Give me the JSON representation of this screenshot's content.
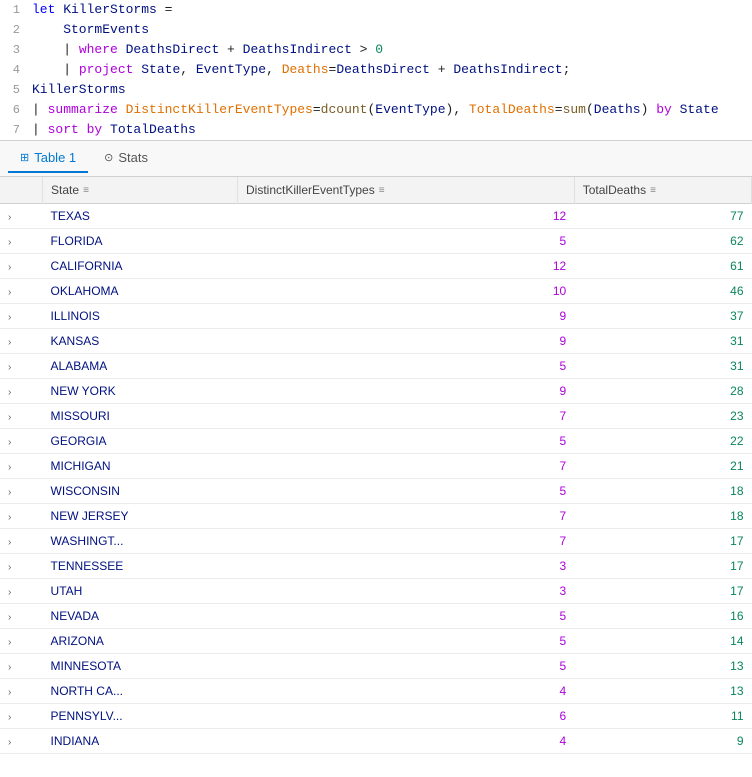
{
  "code": {
    "lines": [
      {
        "num": 1,
        "tokens": [
          {
            "text": "let ",
            "class": "kw-let"
          },
          {
            "text": "KillerStorms",
            "class": "var-name"
          },
          {
            "text": " =",
            "class": "op-gt"
          }
        ]
      },
      {
        "num": 2,
        "tokens": [
          {
            "text": "    StormEvents",
            "class": "var-storm"
          }
        ]
      },
      {
        "num": 3,
        "tokens": [
          {
            "text": "    | ",
            "class": "kw-pipe"
          },
          {
            "text": "where ",
            "class": "kw-where"
          },
          {
            "text": "DeathsDirect",
            "class": "var-name"
          },
          {
            "text": " + ",
            "class": "op-gt"
          },
          {
            "text": "DeathsIndirect",
            "class": "var-name"
          },
          {
            "text": " > ",
            "class": "op-gt"
          },
          {
            "text": "0",
            "class": "num"
          }
        ]
      },
      {
        "num": 4,
        "tokens": [
          {
            "text": "    | ",
            "class": "kw-pipe"
          },
          {
            "text": "project ",
            "class": "kw-project"
          },
          {
            "text": "State",
            "class": "var-name"
          },
          {
            "text": ", ",
            "class": "op-gt"
          },
          {
            "text": "EventType",
            "class": "var-name"
          },
          {
            "text": ", ",
            "class": "op-gt"
          },
          {
            "text": "Deaths",
            "class": "param-name"
          },
          {
            "text": "=",
            "class": "op-gt"
          },
          {
            "text": "DeathsDirect",
            "class": "var-name"
          },
          {
            "text": " + ",
            "class": "op-gt"
          },
          {
            "text": "DeathsIndirect",
            "class": "var-name"
          },
          {
            "text": ";",
            "class": "op-gt"
          }
        ]
      },
      {
        "num": 5,
        "tokens": [
          {
            "text": "KillerStorms",
            "class": "var-name"
          }
        ]
      },
      {
        "num": 6,
        "tokens": [
          {
            "text": "| ",
            "class": "kw-pipe"
          },
          {
            "text": "summarize ",
            "class": "kw-summarize"
          },
          {
            "text": "DistinctKillerEventTypes",
            "class": "param-name"
          },
          {
            "text": "=",
            "class": "op-gt"
          },
          {
            "text": "dcount",
            "class": "fn-name"
          },
          {
            "text": "(",
            "class": "op-gt"
          },
          {
            "text": "EventType",
            "class": "var-name"
          },
          {
            "text": "), ",
            "class": "op-gt"
          },
          {
            "text": "TotalDeaths",
            "class": "param-name"
          },
          {
            "text": "=",
            "class": "op-gt"
          },
          {
            "text": "sum",
            "class": "fn-name"
          },
          {
            "text": "(",
            "class": "op-gt"
          },
          {
            "text": "Deaths",
            "class": "var-name"
          },
          {
            "text": ") ",
            "class": "op-gt"
          },
          {
            "text": "by ",
            "class": "kw-by"
          },
          {
            "text": "State",
            "class": "var-name"
          }
        ]
      },
      {
        "num": 7,
        "tokens": [
          {
            "text": "| ",
            "class": "kw-pipe"
          },
          {
            "text": "sort ",
            "class": "kw-sort"
          },
          {
            "text": "by ",
            "class": "kw-by"
          },
          {
            "text": "TotalDeaths",
            "class": "var-name"
          }
        ]
      }
    ]
  },
  "tabs": [
    {
      "label": "Table 1",
      "icon": "⊞",
      "active": true
    },
    {
      "label": "Stats",
      "icon": "⊙",
      "active": false
    }
  ],
  "table": {
    "columns": [
      {
        "label": "",
        "key": "expand"
      },
      {
        "label": "State",
        "key": "state"
      },
      {
        "label": "DistinctKillerEventTypes",
        "key": "distinct"
      },
      {
        "label": "TotalDeaths",
        "key": "total"
      }
    ],
    "rows": [
      {
        "state": "TEXAS",
        "distinct": 12,
        "total": 77
      },
      {
        "state": "FLORIDA",
        "distinct": 5,
        "total": 62
      },
      {
        "state": "CALIFORNIA",
        "distinct": 12,
        "total": 61
      },
      {
        "state": "OKLAHOMA",
        "distinct": 10,
        "total": 46
      },
      {
        "state": "ILLINOIS",
        "distinct": 9,
        "total": 37
      },
      {
        "state": "KANSAS",
        "distinct": 9,
        "total": 31
      },
      {
        "state": "ALABAMA",
        "distinct": 5,
        "total": 31
      },
      {
        "state": "NEW YORK",
        "distinct": 9,
        "total": 28
      },
      {
        "state": "MISSOURI",
        "distinct": 7,
        "total": 23
      },
      {
        "state": "GEORGIA",
        "distinct": 5,
        "total": 22
      },
      {
        "state": "MICHIGAN",
        "distinct": 7,
        "total": 21
      },
      {
        "state": "WISCONSIN",
        "distinct": 5,
        "total": 18
      },
      {
        "state": "NEW JERSEY",
        "distinct": 7,
        "total": 18
      },
      {
        "state": "WASHINGT...",
        "distinct": 7,
        "total": 17
      },
      {
        "state": "TENNESSEE",
        "distinct": 3,
        "total": 17
      },
      {
        "state": "UTAH",
        "distinct": 3,
        "total": 17
      },
      {
        "state": "NEVADA",
        "distinct": 5,
        "total": 16
      },
      {
        "state": "ARIZONA",
        "distinct": 5,
        "total": 14
      },
      {
        "state": "MINNESOTA",
        "distinct": 5,
        "total": 13
      },
      {
        "state": "NORTH CA...",
        "distinct": 4,
        "total": 13
      },
      {
        "state": "PENNSYLV...",
        "distinct": 6,
        "total": 11
      },
      {
        "state": "INDIANA",
        "distinct": 4,
        "total": 9
      }
    ]
  }
}
